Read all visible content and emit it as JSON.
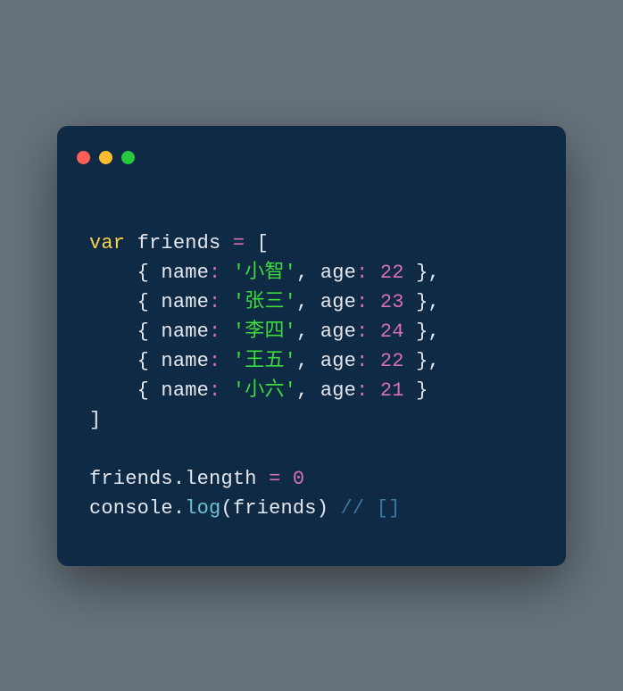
{
  "code": {
    "keyword_var": "var",
    "varname": "friends",
    "eq": "=",
    "lbracket": "[",
    "rows": [
      {
        "name": "'小智'",
        "age": "22"
      },
      {
        "name": "'张三'",
        "age": "23"
      },
      {
        "name": "'李四'",
        "age": "24"
      },
      {
        "name": "'王五'",
        "age": "22"
      },
      {
        "name": "'小六'",
        "age": "21"
      }
    ],
    "prop_name": "name",
    "prop_age": "age",
    "rbracket": "]",
    "stmt2_obj": "friends",
    "stmt2_prop": "length",
    "stmt2_val": "0",
    "stmt3_obj": "console",
    "stmt3_fn": "log",
    "stmt3_arg": "friends",
    "comment": "// []"
  }
}
